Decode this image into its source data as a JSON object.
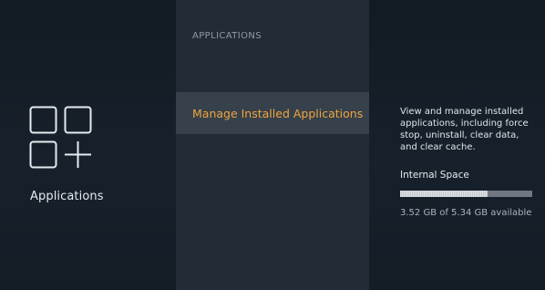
{
  "left_panel": {
    "icon": "applications-grid-icon",
    "label": "Applications"
  },
  "middle_panel": {
    "section_header": "APPLICATIONS",
    "items": [
      {
        "label": "Manage Installed Applications",
        "selected": true
      }
    ]
  },
  "right_panel": {
    "description": "View and manage installed applications, including force stop, uninstall, clear data, and clear cache.",
    "storage": {
      "label": "Internal Space",
      "used_fraction": 0.66,
      "text": "3.52 GB of 5.34 GB available"
    }
  },
  "colors": {
    "background": "#141c24",
    "middle_panel": "#222c36",
    "selected_item": "#36414b",
    "accent": "#f0a340"
  }
}
